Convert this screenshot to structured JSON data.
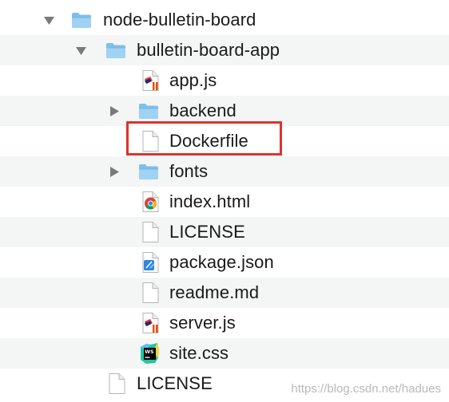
{
  "tree": {
    "root_folder": "node-bulletin-board",
    "app_folder": "bulletin-board-app",
    "items": [
      {
        "label": "app.js"
      },
      {
        "label": "backend"
      },
      {
        "label": "Dockerfile"
      },
      {
        "label": "fonts"
      },
      {
        "label": "index.html"
      },
      {
        "label": "LICENSE"
      },
      {
        "label": "package.json"
      },
      {
        "label": "readme.md"
      },
      {
        "label": "server.js"
      },
      {
        "label": "site.css"
      }
    ],
    "root_license": "LICENSE"
  },
  "icons": {
    "folder": "folder-icon",
    "js": "javascript-file-icon",
    "doc": "blank-document-icon",
    "html": "chrome-html-icon",
    "json": "xcode-json-icon",
    "css": "webstorm-css-icon"
  },
  "colors": {
    "highlight": "#e1322b",
    "folder": "#8cc8f0",
    "alt_row": "#f4f5f5"
  },
  "watermark": "https://blog.csdn.net/hadues"
}
